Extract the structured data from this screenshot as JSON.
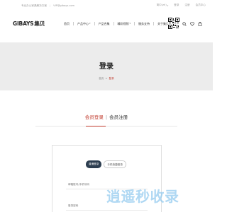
{
  "topbar": {
    "tagline": "专业办公家具解决方案",
    "email": "VIP@gibays.com",
    "lang": "简中(zh)",
    "login": "登录",
    "register": "注册",
    "member_center": "会员中心"
  },
  "header": {
    "logo_text": "GIBAYS",
    "logo_cn": "集贝",
    "nav": [
      {
        "label": "首页"
      },
      {
        "label": "产品中心"
      },
      {
        "label": "产品合集"
      },
      {
        "label": "精彩视频"
      },
      {
        "label": "服务支持"
      },
      {
        "label": "关于集贝"
      }
    ]
  },
  "banner": {
    "title": "登录",
    "breadcrumb_home": "首页",
    "breadcrumb_current": "登录"
  },
  "tabs": {
    "login": "会员登录",
    "register": "会员注册"
  },
  "form": {
    "mode_password": "普通登录",
    "mode_sms": "手机快捷登录",
    "account_placeholder": "邮箱账号/手机号码",
    "password_placeholder": "登录密码"
  },
  "watermark": {
    "text": "逍遥秒收录"
  },
  "colors": {
    "accent": "#c0392b",
    "dark_button": "#2d3e50",
    "banner_bg": "#ececec"
  }
}
